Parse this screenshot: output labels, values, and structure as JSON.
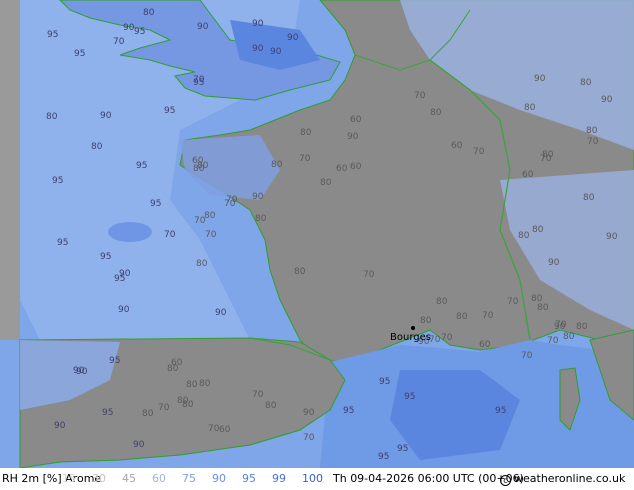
{
  "map": {
    "colors": {
      "sea": "#7fa6e8",
      "sea_light": "#a9c6f3",
      "land_grey": "#8a8a8a",
      "land_light": "#aab8d8",
      "high_rh": "#5b86df",
      "coast": "#2f9e2f",
      "border": "#3aa43a",
      "label": "#5a5a5a"
    },
    "city": "Bourges",
    "labels_sea": [
      "70",
      "80",
      "90",
      "70",
      "95",
      "90",
      "80",
      "90",
      "70",
      "90",
      "95",
      "90",
      "95",
      "95",
      "95",
      "90",
      "95",
      "90",
      "90",
      "95",
      "95",
      "95",
      "95",
      "90",
      "95",
      "95",
      "95",
      "90",
      "95",
      "95",
      "90",
      "80",
      "90",
      "90",
      "95",
      "95",
      "95",
      "95",
      "90"
    ],
    "labels_land": [
      "80",
      "70",
      "80",
      "60",
      "70",
      "80",
      "60",
      "80",
      "80",
      "70",
      "80",
      "90",
      "80",
      "70",
      "60",
      "80",
      "70",
      "80",
      "80",
      "70",
      "90",
      "80",
      "70",
      "90",
      "80",
      "60",
      "80",
      "70",
      "80",
      "70",
      "80",
      "60",
      "70",
      "80",
      "80",
      "90",
      "70",
      "80",
      "60",
      "70",
      "80",
      "90",
      "80",
      "70",
      "80",
      "70",
      "60",
      "80",
      "70",
      "80",
      "90",
      "80",
      "70",
      "80",
      "70",
      "90",
      "80",
      "60",
      "70",
      "80",
      "80",
      "70",
      "90",
      "80",
      "70",
      "80",
      "60",
      "70",
      "80",
      "90"
    ]
  },
  "footer": {
    "left_label": "RH  2m  [%]  Arome",
    "datetime": "Th 09-04-2026 06:00 UTC (00+06)",
    "site": "weatheronline.co.uk",
    "legend": [
      {
        "value": "15",
        "color": "#d8d8d8"
      },
      {
        "value": "30",
        "color": "#c4c4c4"
      },
      {
        "value": "45",
        "color": "#a8a8a8"
      },
      {
        "value": "60",
        "color": "#9fb4e6"
      },
      {
        "value": "75",
        "color": "#7f9fe0"
      },
      {
        "value": "90",
        "color": "#6c8fdc"
      },
      {
        "value": "95",
        "color": "#5a7fd8"
      },
      {
        "value": "99",
        "color": "#4b6fd0"
      },
      {
        "value": "100",
        "color": "#3c60c8"
      }
    ]
  }
}
